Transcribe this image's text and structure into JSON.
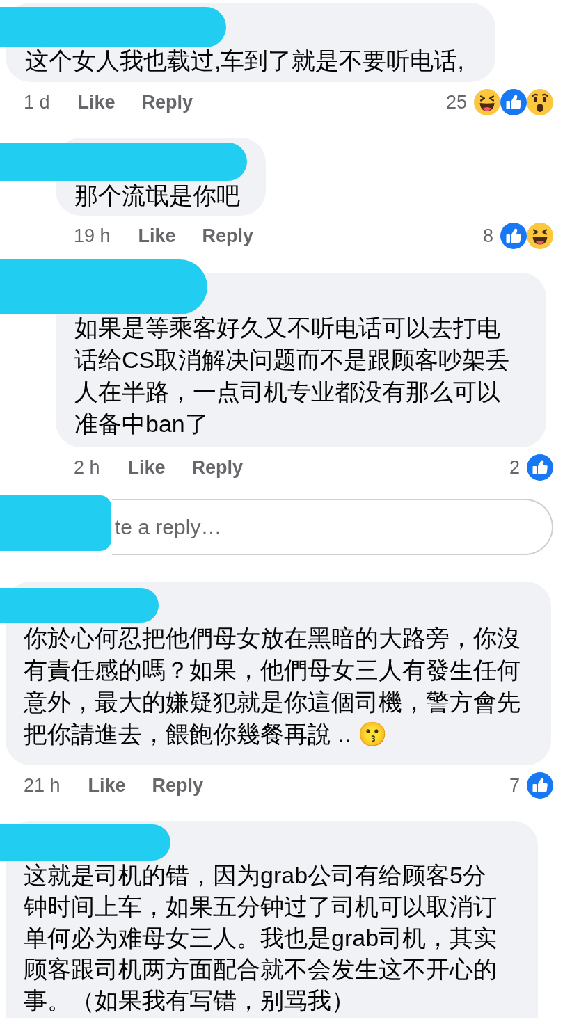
{
  "comments": [
    {
      "text": "这个女人我也载过,车到了就是不要听电话,",
      "time": "1 d",
      "like_label": "Like",
      "reply_label": "Reply",
      "reaction_count": "25",
      "reactions": [
        {
          "kind": "haha"
        },
        {
          "kind": "like"
        },
        {
          "kind": "wow"
        }
      ],
      "replies": [
        {
          "text": "那个流氓是你吧",
          "time": "19 h",
          "like_label": "Like",
          "reply_label": "Reply",
          "reaction_count": "8",
          "reactions": [
            {
              "kind": "like"
            },
            {
              "kind": "haha"
            }
          ]
        },
        {
          "text": "如果是等乘客好久又不听电话可以去打电话给CS取消解决问题而不是跟顾客吵架丢人在半路，一点司机专业都没有那么可以准备中ban了",
          "time": "2 h",
          "like_label": "Like",
          "reply_label": "Reply",
          "reaction_count": "2",
          "reactions": [
            {
              "kind": "like"
            }
          ]
        }
      ],
      "reply_box": {
        "placeholder": "te a reply…"
      }
    },
    {
      "text": "你於心何忍把他們母女放在黑暗的大路旁，你沒有責任感的嗎？如果，他們母女三人有發生任何意外，最大的嫌疑犯就是你這個司機，警方會先把你請進去，餵飽你幾餐再說 .. 😗",
      "time": "21 h",
      "like_label": "Like",
      "reply_label": "Reply",
      "reaction_count": "7",
      "reactions": [
        {
          "kind": "like"
        }
      ]
    },
    {
      "text": "这就是司机的错，因为grab公司有给顾客5分钟时间上车，如果五分钟过了司机可以取消订单何必为难母女三人。我也是grab司机，其实顾客跟司机两方面配合就不会发生这不开心的事。（如果我有写错，别骂我）"
    }
  ]
}
